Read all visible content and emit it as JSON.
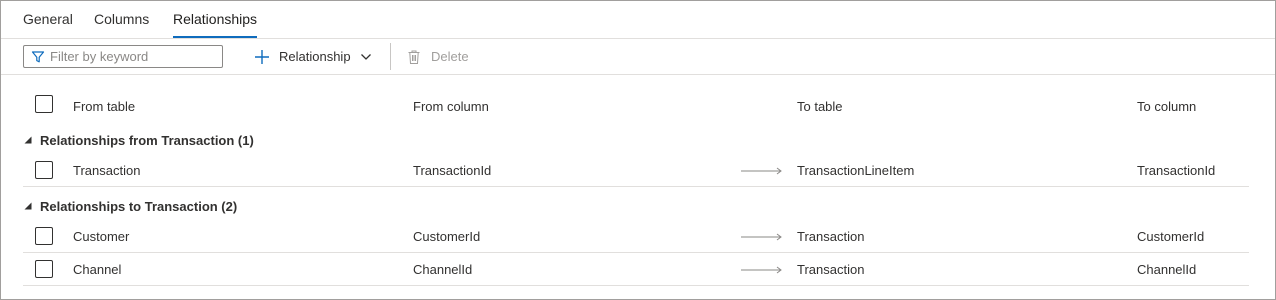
{
  "tabs": [
    {
      "label": "General",
      "active": false
    },
    {
      "label": "Columns",
      "active": false
    },
    {
      "label": "Relationships",
      "active": true
    }
  ],
  "toolbar": {
    "filter_placeholder": "Filter by keyword",
    "filter_value": "",
    "relationship_label": "Relationship",
    "delete_label": "Delete",
    "delete_enabled": false
  },
  "grid": {
    "columns": [
      "From table",
      "From column",
      "To table",
      "To column"
    ],
    "groups": [
      {
        "label": "Relationships from Transaction (1)",
        "rows": [
          {
            "from_table": "Transaction",
            "from_column": "TransactionId",
            "to_table": "TransactionLineItem",
            "to_column": "TransactionId"
          }
        ]
      },
      {
        "label": "Relationships to Transaction (2)",
        "rows": [
          {
            "from_table": "Customer",
            "from_column": "CustomerId",
            "to_table": "Transaction",
            "to_column": "CustomerId"
          },
          {
            "from_table": "Channel",
            "from_column": "ChannelId",
            "to_table": "Transaction",
            "to_column": "ChannelId"
          }
        ]
      }
    ]
  },
  "colors": {
    "accent": "#0f6cbd",
    "border": "#e1dfdd",
    "text": "#323130",
    "disabled": "#a19f9d"
  }
}
